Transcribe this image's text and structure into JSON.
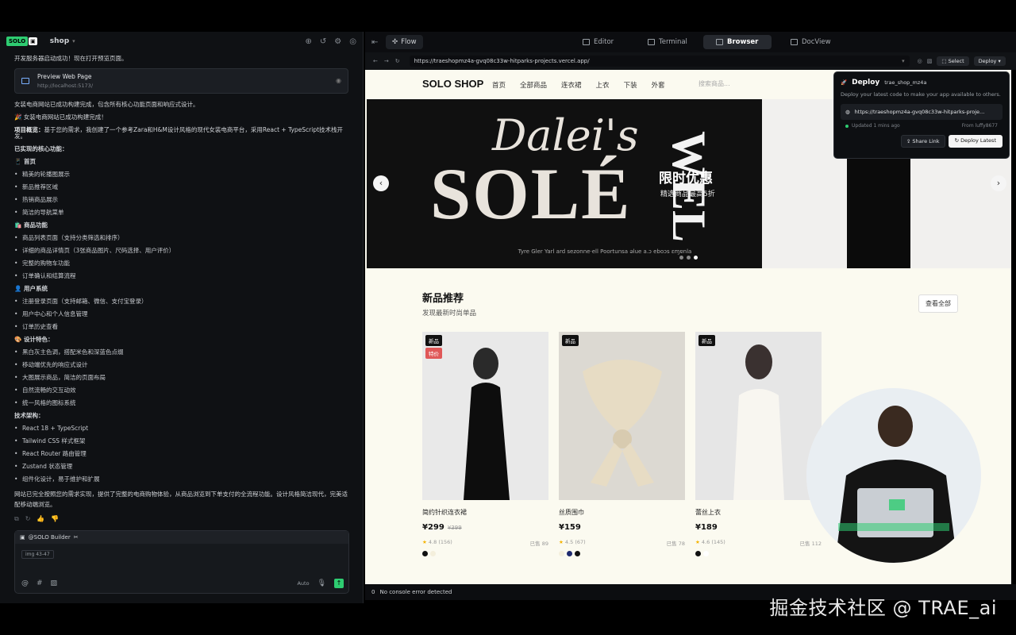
{
  "watermark": "掘金技术社区 @ TRAE_ai",
  "chat": {
    "logo": "SOLO",
    "project": "shop",
    "messages": {
      "m1": "开发服务器启动成功！现在打开预览页面。",
      "card_title": "Preview Web Page",
      "card_url": "http://localhost:5173/",
      "m2": "女装电商网站已成功构建完成，包含所有核心功能页面和响应式设计。",
      "m3": "🎉 女装电商网站已成功构建完成！",
      "m4_bold": "项目概览：",
      "m4": "基于您的需求，我创建了一个参考Zara和H&M设计风格的现代女装电商平台，采用React + TypeScript技术栈开发。",
      "m5": "已实现的核心功能：",
      "s1": "📱 首页",
      "s1_items": [
        "精美的轮播图展示",
        "新品推荐区域",
        "热销商品展示",
        "简洁的导航菜单"
      ],
      "s2": "🛍️ 商品功能",
      "s2_items": [
        "商品列表页面（支持分类筛选和排序）",
        "详细的商品详情页（3张商品图片、尺码选择、用户评价）",
        "完整的购物车功能",
        "订单确认和结算流程"
      ],
      "s3": "👤 用户系统",
      "s3_items": [
        "注册登录页面（支持邮箱、微信、支付宝登录）",
        "用户中心和个人信息管理",
        "订单历史查看"
      ],
      "s4": "🎨 设计特色：",
      "s4_items": [
        "黑白灰主色调，搭配米色和深蓝色点缀",
        "移动端优先的响应式设计",
        "大图展示商品，简洁的页面布局",
        "自然流畅的交互动效",
        "统一风格的图标系统"
      ],
      "s5": "技术架构：",
      "s5_items": [
        "React 18 + TypeScript",
        "Tailwind CSS 样式框架",
        "React Router 路由管理",
        "Zustand 状态管理",
        "组件化设计，易于维护和扩展"
      ],
      "m6": "网站已完全按照您的需求实现，提供了完整的电商购物体验，从商品浏览到下单支付的全流程功能。设计风格简洁现代，完美适配移动端浏览。"
    },
    "composer": {
      "mention": "@SOLO Builder",
      "chip": "img 43-47",
      "mode": "Auto"
    }
  },
  "tabs": {
    "flow": "Flow",
    "editor": "Editor",
    "terminal": "Terminal",
    "browser": "Browser",
    "docview": "DocView"
  },
  "browser": {
    "url": "https://traeshopmz4a-gvq08c33w-hitparks-projects.vercel.app/",
    "select": "Select",
    "deploy": "Deploy"
  },
  "site": {
    "brand": "SOLO SHOP",
    "menu": [
      "首页",
      "全部商品",
      "连衣裙",
      "上衣",
      "下装",
      "外套"
    ],
    "search_placeholder": "搜索商品...",
    "hero": {
      "script": "Dalei's",
      "big": "SOLÉ",
      "vertical": "WEL",
      "promo": "限时优惠",
      "promo_sub": "精选商品最高5折",
      "fine": "Tyre Gler Yarl ard sezonne·ell Poortunsa ǝlue a.ɔ eboɔs ɛɱɐnla"
    },
    "new_title": "新品推荐",
    "new_sub": "发现最新时尚单品",
    "view_all": "查看全部",
    "products": [
      {
        "badge": "新品",
        "badge2": "特价",
        "name": "简约针织连衣裙",
        "price": "¥299",
        "old": "¥399",
        "rating": "4.8",
        "reviews": "(156)",
        "sold": "已售 89",
        "colors": [
          "#111111",
          "#f4efdc"
        ]
      },
      {
        "badge": "新品",
        "badge2": "",
        "name": "丝质围巾",
        "price": "¥159",
        "old": "",
        "rating": "4.5",
        "reviews": "(67)",
        "sold": "已售 78",
        "colors": [
          "#f4efdc",
          "#1e2a6e",
          "#111111"
        ]
      },
      {
        "badge": "新品",
        "badge2": "",
        "name": "蕾丝上衣",
        "price": "¥189",
        "old": "",
        "rating": "4.6",
        "reviews": "(145)",
        "sold": "已售 112",
        "colors": [
          "#111111",
          "#ffffff"
        ]
      }
    ]
  },
  "console": {
    "count": "0",
    "text": "No console error detected"
  },
  "deploy_popover": {
    "title": "Deploy",
    "project": "trae_shop_mz4a",
    "desc": "Deploy your latest code to make your app available to others.",
    "url": "https://traeshopmz4a-gvq08c33w-hitparks-proje...",
    "updated": "Updated 1 mins ago",
    "from": "From luffy8677",
    "share": "Share Link",
    "redeploy": "Deploy Latest"
  },
  "colors": {
    "accent": "#2ecc71",
    "bg_dark": "#0f1114",
    "page_bg": "#fbfaf0"
  }
}
